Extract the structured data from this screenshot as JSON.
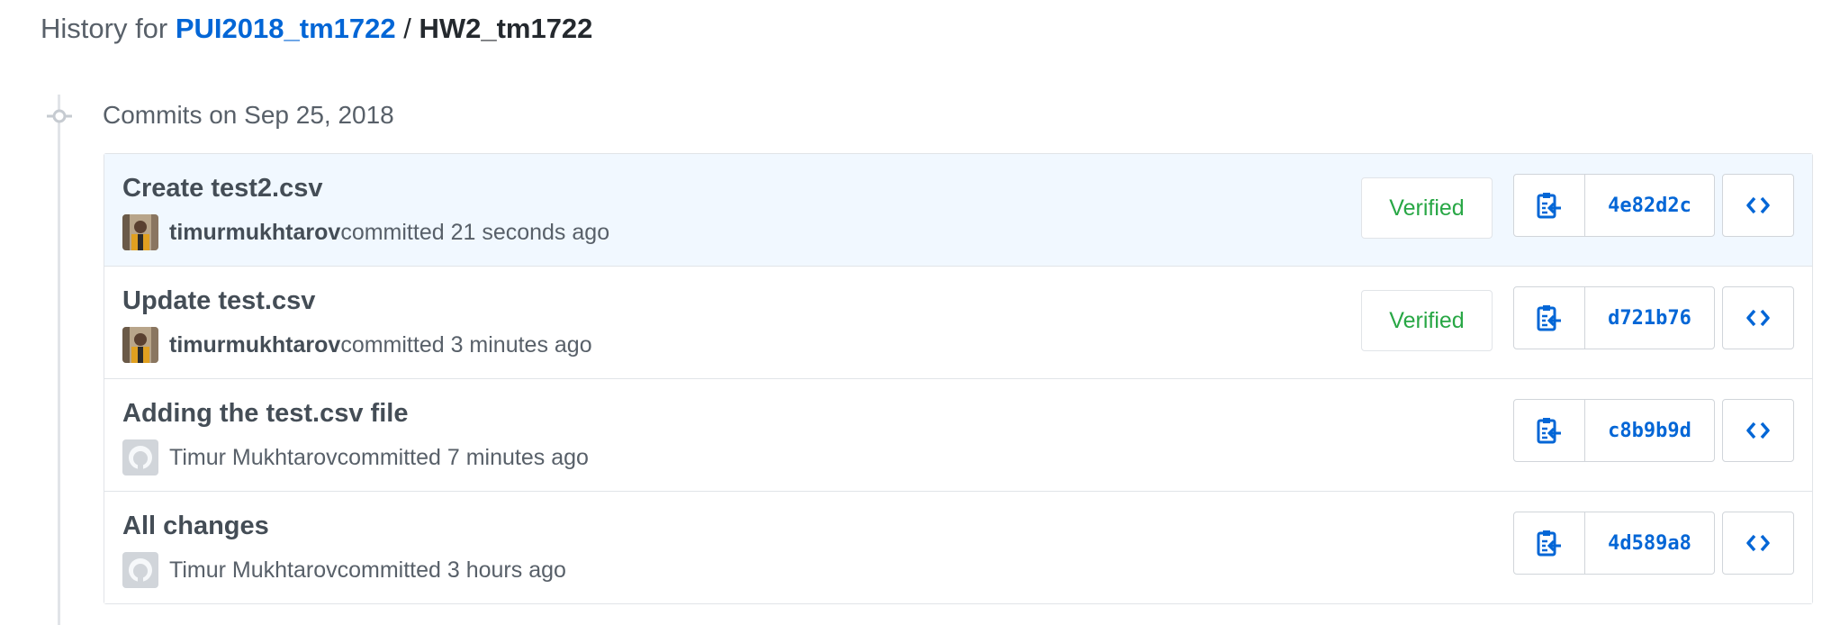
{
  "breadcrumb": {
    "prefix": "History for ",
    "repo": "PUI2018_tm1722",
    "separator": " / ",
    "path": "HW2_tm1722"
  },
  "timeline": {
    "group_title": "Commits on Sep 25, 2018"
  },
  "commits": [
    {
      "title": "Create test2.csv",
      "author": "timurmukhtarov",
      "action": " committed 21 seconds ago",
      "avatar": "photo-avatar",
      "verified_label": "Verified",
      "sha": "4e82d2c"
    },
    {
      "title": "Update test.csv",
      "author": "timurmukhtarov",
      "action": " committed 3 minutes ago",
      "avatar": "photo-avatar",
      "verified_label": "Verified",
      "sha": "d721b76"
    },
    {
      "title": "Adding the test.csv file",
      "author": "Timur Mukhtarov",
      "action": " committed 7 minutes ago",
      "avatar": "github-octocat-avatar",
      "sha": "c8b9b9d"
    },
    {
      "title": "All changes",
      "author": "Timur Mukhtarov",
      "action": " committed 3 hours ago",
      "avatar": "github-octocat-avatar",
      "sha": "4d589a8"
    }
  ],
  "icons": {
    "copy": "clippy-icon",
    "browse": "code-icon",
    "timeline": "git-commit-icon"
  },
  "colors": {
    "link": "#0366d6",
    "verified": "#28a745",
    "highlight_row": "#f1f8ff",
    "border": "#e1e4e8"
  }
}
